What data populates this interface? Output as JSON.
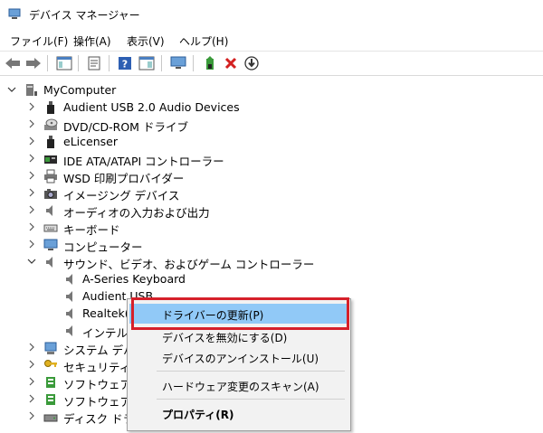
{
  "window": {
    "title": "デバイス マネージャー"
  },
  "menu": [
    "ファイル(F)",
    "操作(A)",
    "表示(V)",
    "ヘルプ(H)"
  ],
  "tree": {
    "root": {
      "label": "MyComputer",
      "expanded": true
    },
    "categories": [
      {
        "label": "Audient USB 2.0 Audio Devices",
        "icon": "usb-device-icon"
      },
      {
        "label": "DVD/CD-ROM ドライブ",
        "icon": "dvd-drive-icon"
      },
      {
        "label": "eLicenser",
        "icon": "usb-device-icon"
      },
      {
        "label": "IDE ATA/ATAPI コントローラー",
        "icon": "ide-controller-icon"
      },
      {
        "label": "WSD 印刷プロバイダー",
        "icon": "printer-icon"
      },
      {
        "label": "イメージング デバイス",
        "icon": "camera-icon"
      },
      {
        "label": "オーディオの入力および出力",
        "icon": "speaker-icon"
      },
      {
        "label": "キーボード",
        "icon": "keyboard-icon"
      },
      {
        "label": "コンピューター",
        "icon": "monitor-icon"
      },
      {
        "label": "サウンド、ビデオ、およびゲーム コントローラー",
        "icon": "speaker-icon",
        "expanded": true,
        "children": [
          {
            "label": "A-Series Keyboard"
          },
          {
            "label": "Audient USB..."
          },
          {
            "label": "Realtek(R)..."
          },
          {
            "label": "インテル(R)..."
          }
        ]
      },
      {
        "label": "システム デバイス",
        "icon": "system-device-icon"
      },
      {
        "label": "セキュリティ デバイス",
        "icon": "security-device-icon"
      },
      {
        "label": "ソフトウェア コンポーネント",
        "icon": "software-component-icon"
      },
      {
        "label": "ソフトウェア デバイス",
        "icon": "software-device-icon"
      },
      {
        "label": "ディスク ドライブ",
        "icon": "disk-drive-icon"
      }
    ]
  },
  "context_menu": {
    "items": [
      {
        "label": "ドライバーの更新(P)",
        "highlighted": true
      },
      {
        "label": "デバイスを無効にする(D)"
      },
      {
        "label": "デバイスのアンインストール(U)"
      },
      {
        "label": "ハードウェア変更のスキャン(A)"
      },
      {
        "label": "プロパティ(R)",
        "bold": true
      }
    ]
  },
  "colors": {
    "highlight": "#91c9f7",
    "callout": "#d6202a",
    "accent_green": "#3a9a3a",
    "accent_red": "#d32020"
  }
}
